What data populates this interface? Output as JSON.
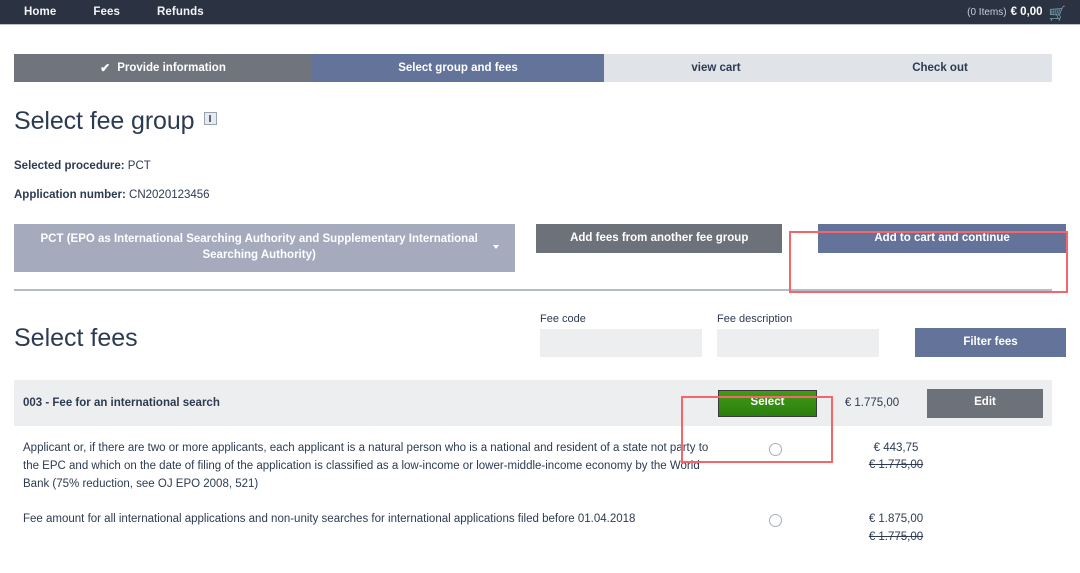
{
  "topbar": {
    "links": [
      {
        "label": "Home"
      },
      {
        "label": "Fees"
      },
      {
        "label": "Refunds"
      }
    ],
    "cart_items": "(0 Items)",
    "cart_total": "€ 0,00",
    "cart_icon": "shopping-cart-icon"
  },
  "steps": [
    {
      "label": "Provide information",
      "check": "✔",
      "state": "done"
    },
    {
      "label": "Select group and fees",
      "state": "active"
    },
    {
      "label": "view cart",
      "state": "todo"
    },
    {
      "label": "Check out",
      "state": "todo"
    }
  ],
  "page": {
    "title": "Select fee group",
    "info_icon": "info-icon",
    "procedure_label": "Selected procedure:",
    "procedure_value": "PCT",
    "application_label": "Application number:",
    "application_value": "CN2020123456"
  },
  "actions": {
    "fee_group_button": "PCT (EPO as International Searching Authority and Supplementary International Searching Authority)",
    "add_another_group": "Add fees from another fee group",
    "add_to_cart": "Add to cart and continue"
  },
  "filters": {
    "section_title": "Select fees",
    "fee_code_label": "Fee code",
    "fee_code_value": "",
    "fee_code_placeholder": "",
    "fee_description_label": "Fee description",
    "fee_description_value": "",
    "fee_description_placeholder": "",
    "filter_button": "Filter fees"
  },
  "fee": {
    "title": "003 - Fee for an international search",
    "select_button": "Select",
    "price": "€ 1.775,00",
    "edit_button": "Edit",
    "options": [
      {
        "description": "Applicant or, if there are two or more applicants, each applicant is a natural person who is a national and resident of a state not party to the EPC and which on the date of filing of the application is classified as a low-income or lower-middle-income economy by the World Bank (75% reduction, see OJ EPO 2008, 521)",
        "price": "€ 443,75",
        "price_original": "€ 1.775,00",
        "selected": false
      },
      {
        "description": "Fee amount for all international applications and non-unity searches for international applications filed before 01.04.2018",
        "price": "€ 1.875,00",
        "price_original": "€ 1.775,00",
        "selected": false
      }
    ]
  },
  "highlights": {
    "add_to_cart_box": "#f4666a",
    "select_box": "#f4666a"
  },
  "colors": {
    "topbar_bg": "#2b3342",
    "step_done": "#70757d",
    "step_active": "#64739a",
    "step_todo": "#e0e3e7",
    "accent_blue": "#64739a",
    "accent_gray": "#6d7179",
    "select_green": "#2e8b12",
    "highlight_red": "#f4666a"
  }
}
